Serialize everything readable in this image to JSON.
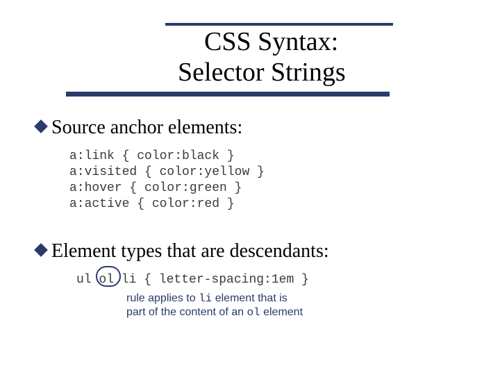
{
  "title": {
    "line1": "CSS Syntax:",
    "line2": "Selector Strings"
  },
  "bullets": {
    "b1": "Source anchor elements:",
    "b2": "Element types that are descendants:"
  },
  "code1": {
    "l1": "a:link { color:black }",
    "l2": "a:visited { color:yellow }",
    "l3": "a:hover { color:green }",
    "l4": "a:active { color:red }"
  },
  "code2": "ul ol li { letter-spacing:1em }",
  "annotation": {
    "pre1": "rule applies to ",
    "li": "li",
    "post1": " element that is",
    "pre2": "part of the content of an ",
    "ol": "ol",
    "post2": " element",
    "circled_token": "ol"
  },
  "colors": {
    "accent": "#2b3a6b"
  }
}
